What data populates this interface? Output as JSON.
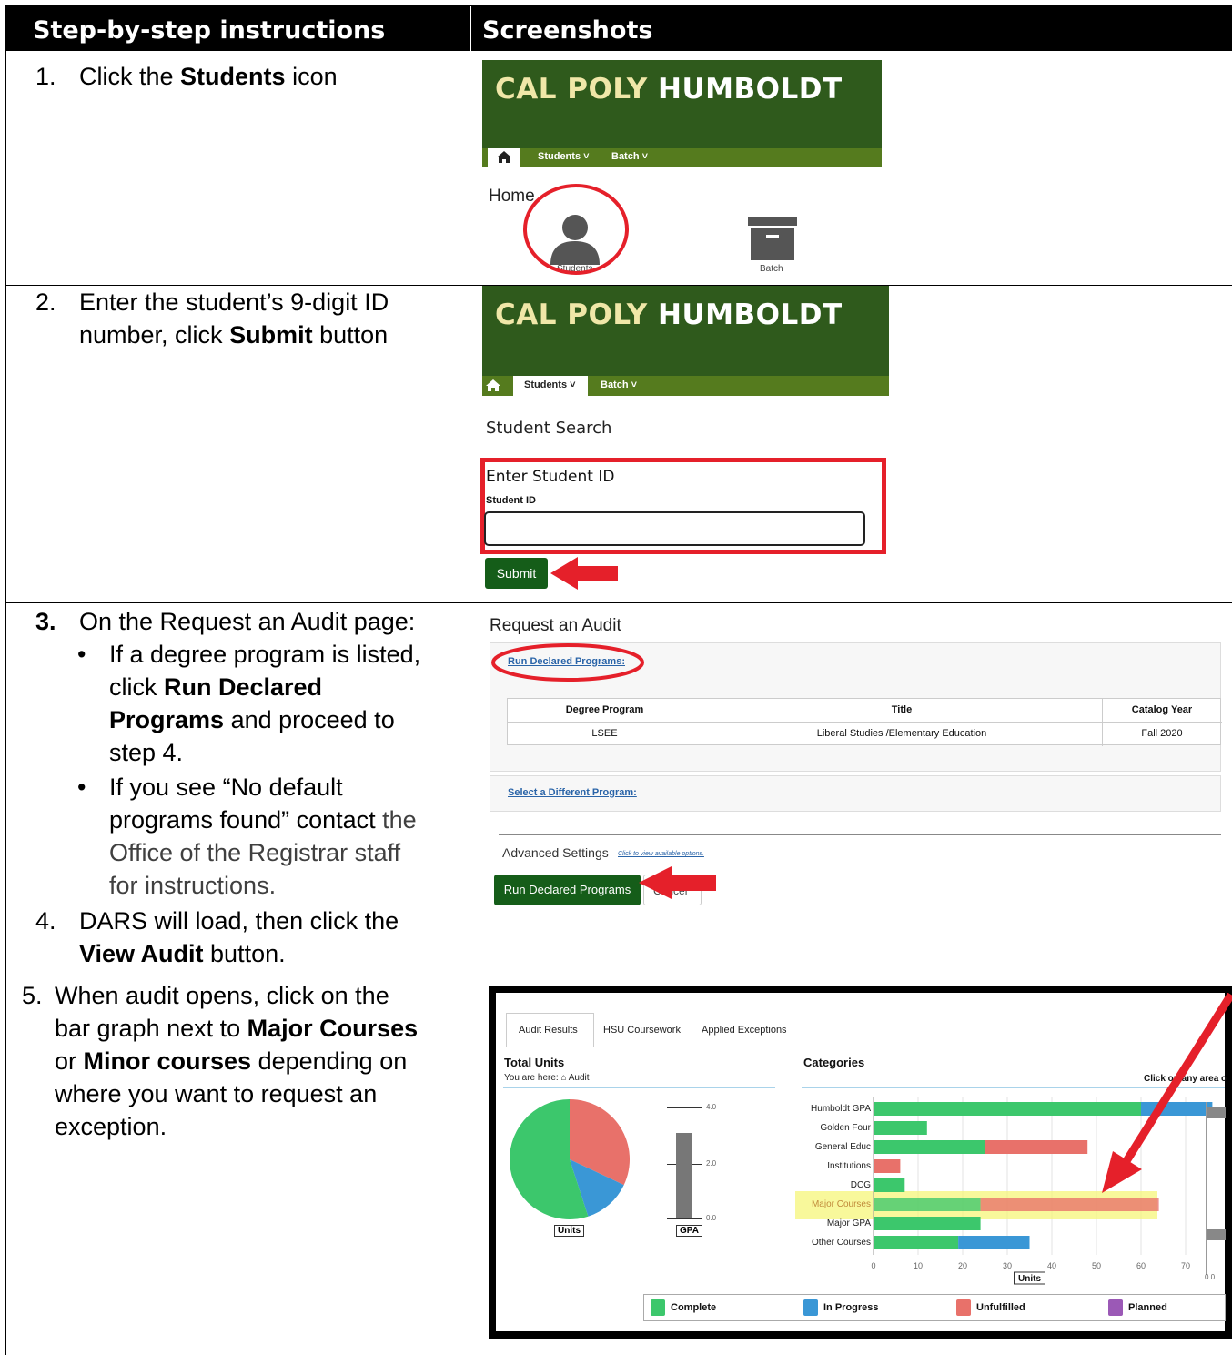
{
  "header": {
    "col1": "Step-by-step instructions",
    "col2": "Screenshots"
  },
  "steps": {
    "s1": {
      "num": "1.",
      "pre": "Click the ",
      "bold": "Students",
      "post": " icon"
    },
    "s2": {
      "num": "2.",
      "line1": "Enter the student’s 9-digit ID",
      "line2_pre": "number, click ",
      "line2_bold": "Submit",
      "line2_post": " button"
    },
    "s3": {
      "num": "3.",
      "intro": "On the Request an Audit page:",
      "b1_l1": "If a degree program is listed,",
      "b1_l2_pre": "click ",
      "b1_l2_bold": "Run Declared",
      "b1_l3_bold": "Programs",
      "b1_l3_post": " and proceed to",
      "b1_l4": "step 4.",
      "b2_l1": "If you see “No default",
      "b2_l2_pre": "programs found” contact ",
      "b2_l2_gray": "the",
      "b2_l3": "Office of the Registrar staff",
      "b2_l4": "for instructions."
    },
    "s4": {
      "num": "4.",
      "line1": "DARS will load, then click the",
      "line2_bold": "View Audit",
      "line2_post": " button."
    },
    "s5": {
      "num": "5.",
      "l1": "When audit opens, click on the",
      "l2_pre": "bar graph next to ",
      "l2_bold": "Major Courses",
      "l3_pre": "or ",
      "l3_bold": "Minor courses",
      "l3_post": " depending on",
      "l4": "where you want to request an",
      "l5": "exception."
    }
  },
  "shot1": {
    "title_a": "CAL POLY",
    "title_b": " HUMBOLDT",
    "nav_students": "Students ˅",
    "nav_batch": "Batch ˅",
    "home": "Home",
    "students_label": "Students",
    "batch_label": "Batch"
  },
  "shot2": {
    "title_a": "CAL POLY",
    "title_b": " HUMBOLDT",
    "nav_students": "Students ˅",
    "nav_batch": "Batch ˅",
    "search_title": "Student Search",
    "enter_title": "Enter Student ID",
    "sid_label": "Student ID",
    "submit": "Submit"
  },
  "shot3": {
    "title": "Request an Audit",
    "run_link": "Run Declared Programs:",
    "col_degree": "Degree Program",
    "col_title": "Title",
    "col_catalog": "Catalog Year",
    "row_degree": "LSEE",
    "row_title": "Liberal Studies /Elementary Education",
    "row_catalog": "Fall 2020",
    "select_link": "Select a Different Program:",
    "advanced": "Advanced Settings",
    "advanced_link": "Click to view available options.",
    "run_btn": "Run Declared Programs",
    "cancel_btn": "Cancel"
  },
  "shot5": {
    "tabs": [
      "Audit Results",
      "HSU Coursework",
      "Applied Exceptions"
    ],
    "total_units": "Total Units",
    "you_are_here": "You are here:",
    "audit_crumb": "Audit",
    "categories": "Categories",
    "click_hint": "Click on any area o",
    "units_label": "Units",
    "gpa_label": "GPA",
    "pie_slices": [
      {
        "name": "Complete",
        "value": 55,
        "color": "#3cc76c"
      },
      {
        "name": "In Progress",
        "value": 13,
        "color": "#3a97d6"
      },
      {
        "name": "Unfulfilled",
        "value": 32,
        "color": "#e8716a"
      }
    ],
    "gpa_scale": [
      "4.0",
      "2.0",
      "0.0"
    ]
  },
  "chart_data": {
    "type": "bar",
    "orientation": "horizontal-stacked",
    "xlabel": "Units",
    "xlim": [
      0,
      70
    ],
    "xticks": [
      "0",
      "10",
      "20",
      "30",
      "40",
      "50",
      "60",
      "70"
    ],
    "right_axis_tick": "0.0",
    "categories": [
      "Humboldt GPA",
      "Golden Four",
      "General Educ",
      "Institutions",
      "DCG",
      "Major Courses",
      "Major GPA",
      "Other Courses"
    ],
    "series": [
      {
        "name": "Complete",
        "color": "#3cc76c",
        "values": [
          60,
          12,
          25,
          0,
          7,
          24,
          24,
          19
        ]
      },
      {
        "name": "In Progress",
        "color": "#3a97d6",
        "values": [
          16,
          0,
          0,
          0,
          0,
          0,
          0,
          16
        ]
      },
      {
        "name": "Unfulfilled",
        "color": "#e8716a",
        "values": [
          0,
          0,
          23,
          6,
          0,
          40,
          0,
          0
        ]
      },
      {
        "name": "Planned",
        "color": "#9b59b6",
        "values": [
          0,
          0,
          0,
          0,
          0,
          0,
          0,
          0
        ]
      }
    ],
    "highlight_category": "Major Courses",
    "legend": [
      "Complete",
      "In Progress",
      "Unfulfilled",
      "Planned"
    ]
  }
}
